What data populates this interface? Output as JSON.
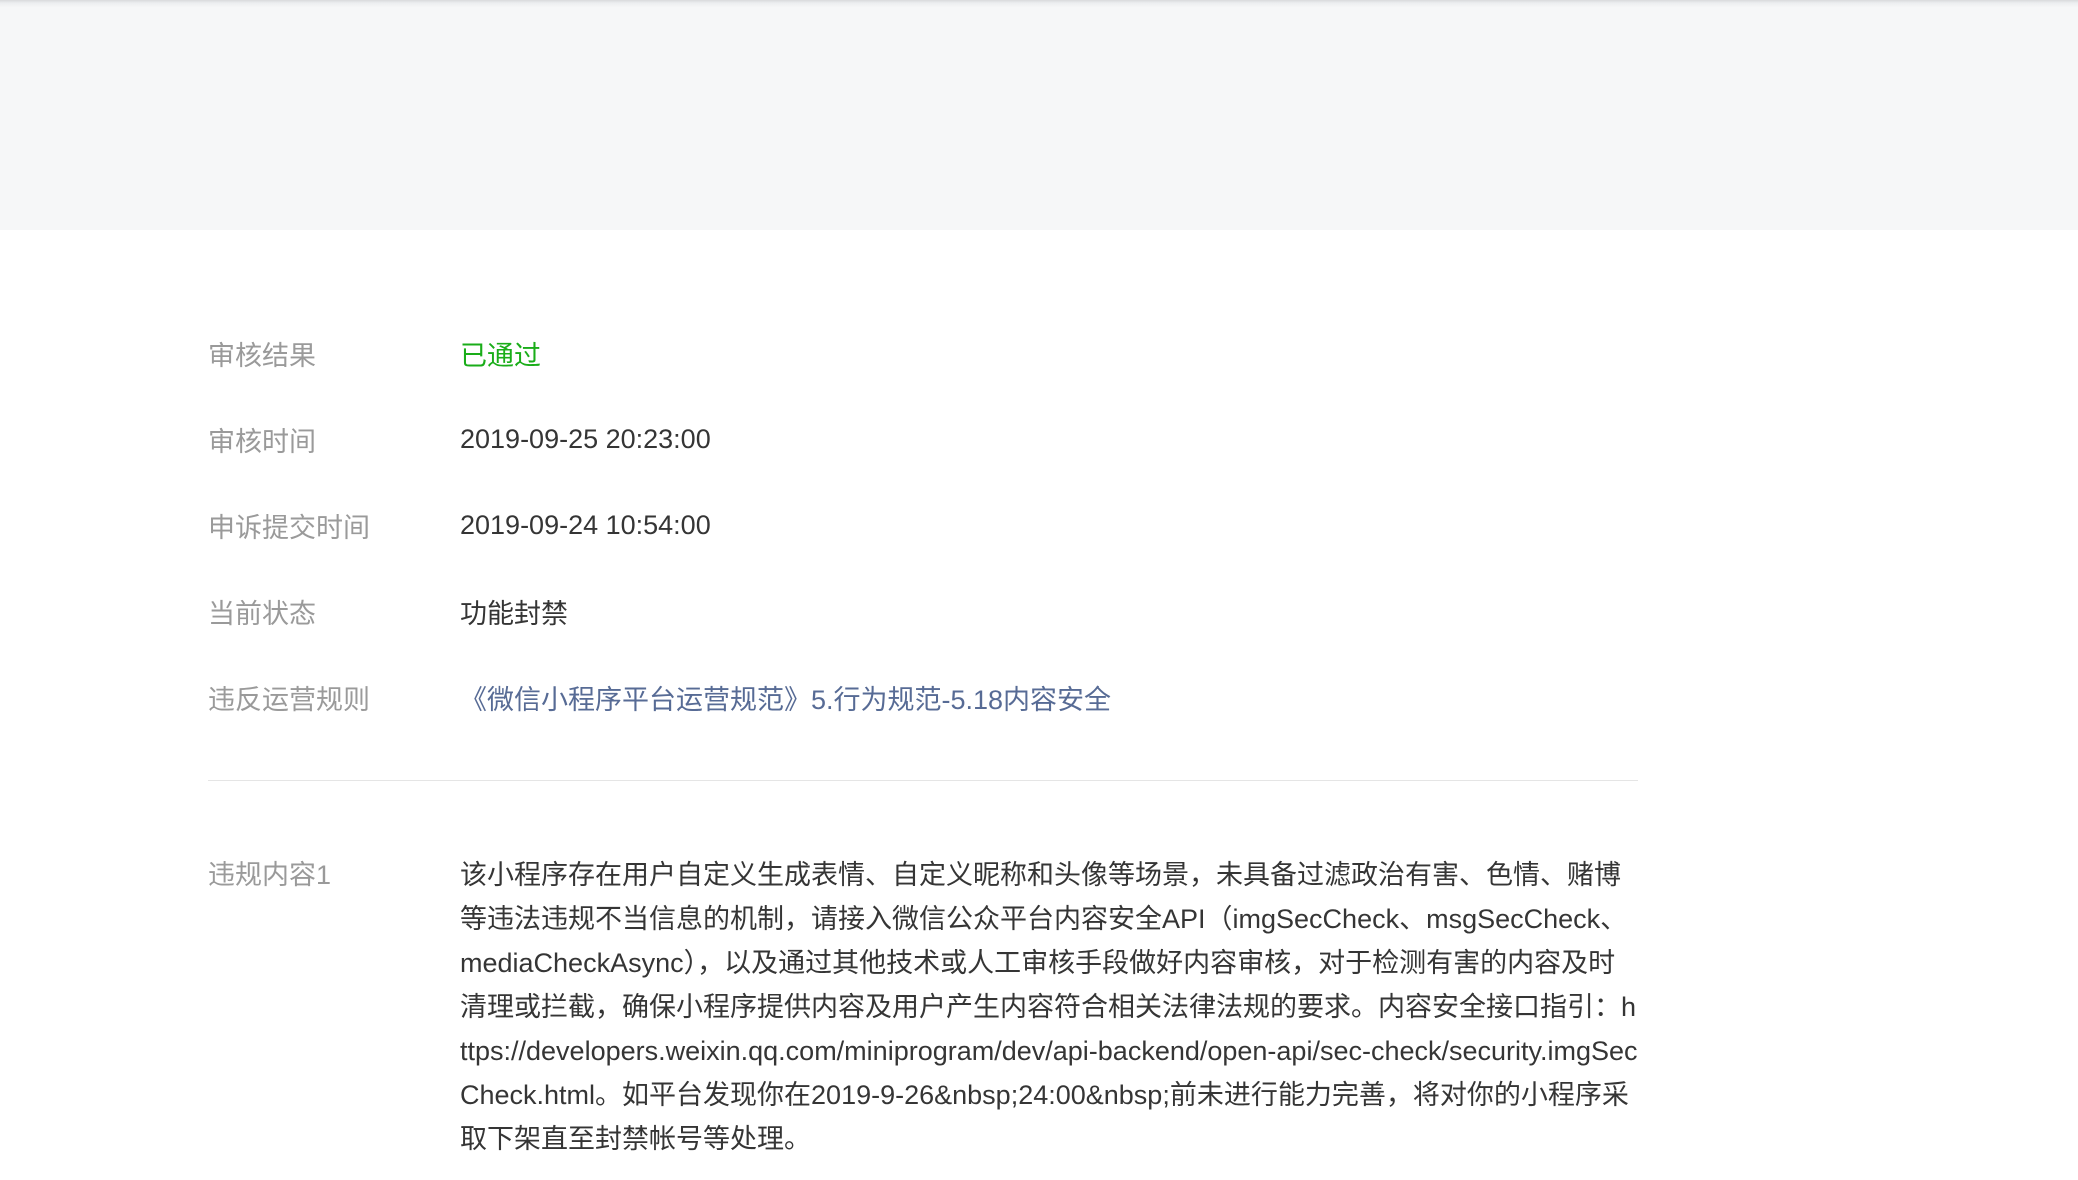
{
  "detail": {
    "rows": [
      {
        "label": "审核结果",
        "value": "已通过",
        "value_color": "#1aad19"
      },
      {
        "label": "审核时间",
        "value": "2019-09-25 20:23:00"
      },
      {
        "label": "申诉提交时间",
        "value": "2019-09-24 10:54:00"
      },
      {
        "label": "当前状态",
        "value": "功能封禁"
      },
      {
        "label": "违反运营规则",
        "value": "《微信小程序平台运营规范》5.行为规范-5.18内容安全",
        "value_color": "#576b95"
      }
    ],
    "violation": {
      "label": "违规内容1",
      "text": "该小程序存在用户自定义生成表情、自定义昵称和头像等场景，未具备过滤政治有害、色情、赌博等违法违规不当信息的机制，请接入微信公众平台内容安全API（imgSecCheck、msgSecCheck、mediaCheckAsync），以及通过其他技术或人工审核手段做好内容审核，对于检测有害的内容及时清理或拦截，确保小程序提供内容及用户产生内容符合相关法律法规的要求。内容安全接口指引：https://developers.weixin.qq.com/miniprogram/dev/api-backend/open-api/sec-check/security.imgSecCheck.html。如平台发现你在2019-9-26&nbsp;24:00&nbsp;前未进行能力完善，将对你的小程序采取下架直至封禁帐号等处理。"
    }
  }
}
